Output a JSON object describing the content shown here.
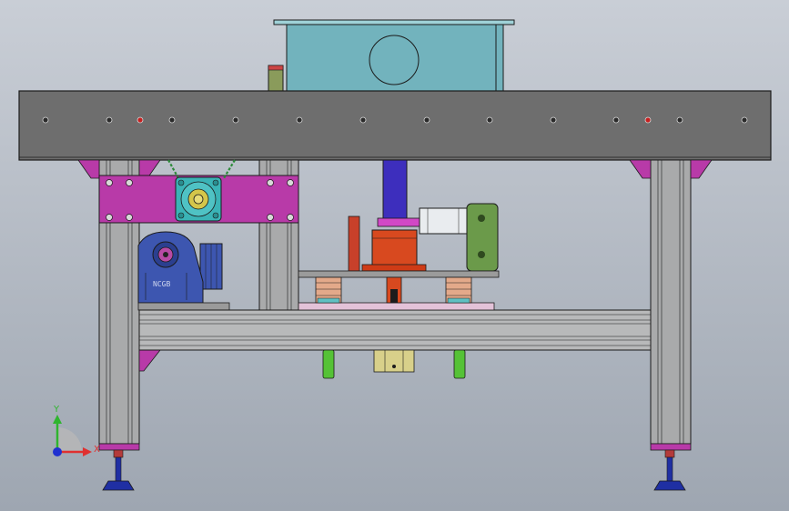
{
  "viewport": {
    "background_top": "#c9ced6",
    "background_bottom": "#9ea6b1"
  },
  "triad": {
    "y_label": "Y",
    "x_label": "X",
    "y_color": "#2fb52f",
    "x_color": "#e03030",
    "z_color": "#2030d0"
  },
  "gearmotor": {
    "brand_text": "NCGB"
  },
  "colors": {
    "beam": "#6e6e6e",
    "frame_aluminum": "#a9aaab",
    "bracket_magenta": "#b83aa8",
    "tank_cyan": "#72b3bd",
    "piston_blue": "#3d2ebd",
    "piston_orange": "#d8491f",
    "guide_green": "#55c236",
    "gearmotor_blue": "#3d56b0",
    "leveling_foot": "#1f2fa3",
    "fastener_red": "#c61f1f"
  }
}
